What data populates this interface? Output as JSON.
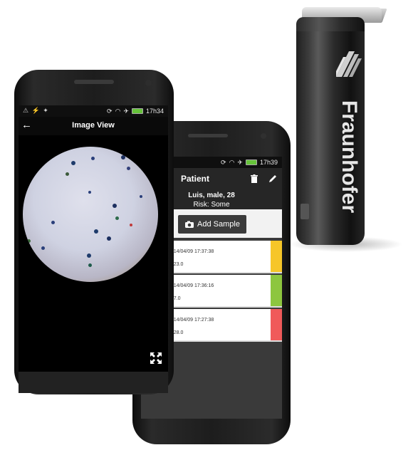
{
  "device": {
    "brand": "Fraunhofer"
  },
  "front_phone": {
    "status_bar": {
      "left_icons": "⚠ ⚡ ✦",
      "time": "17h34"
    },
    "action_bar": {
      "title": "Image View",
      "back_icon": "arrow-back-icon"
    },
    "fullscreen_icon": "fullscreen-icon"
  },
  "back_phone": {
    "status_bar": {
      "time": "17h39"
    },
    "action_bar": {
      "title": "Patient",
      "delete_icon": "trash-icon",
      "edit_icon": "pencil-icon"
    },
    "patient": {
      "name": "Luis, male, 28",
      "risk": "Risk: Some"
    },
    "add_sample_label": "Add Sample",
    "samples": [
      {
        "date": "2014/04/09 17:37:38",
        "value": "a: 23.0",
        "risk_color": "#f6c629"
      },
      {
        "date": "2014/04/09 17:36:16",
        "value": "a: 7.0",
        "risk_color": "#8dc63f"
      },
      {
        "date": "2014/04/09 17:27:38",
        "value": "a: 28.0",
        "risk_color": "#f05a5a"
      }
    ]
  }
}
